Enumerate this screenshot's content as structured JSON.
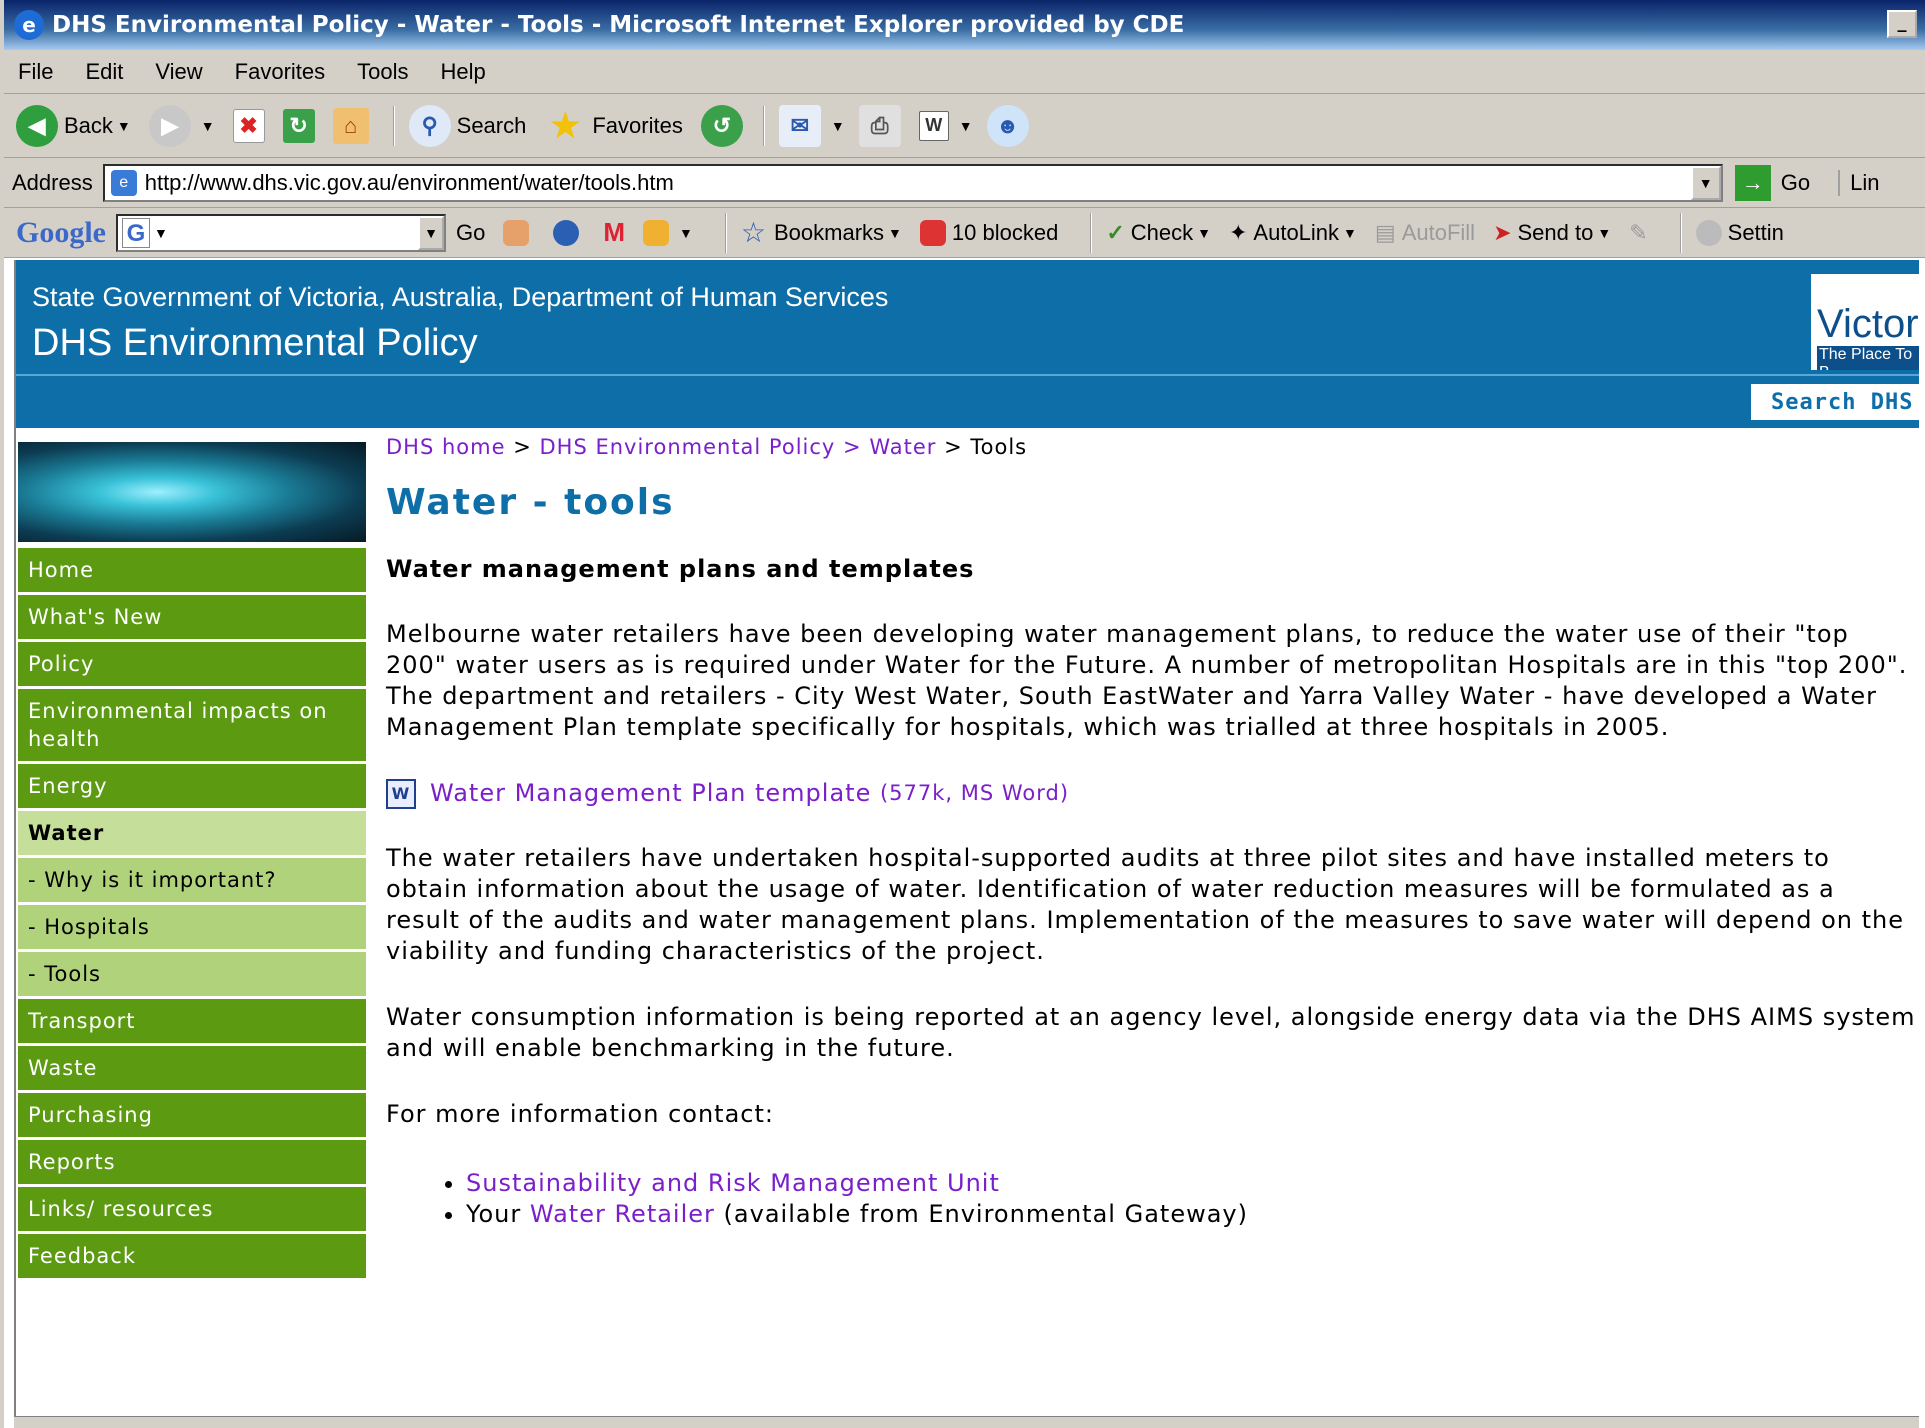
{
  "window": {
    "title": "DHS Environmental Policy - Water - Tools - Microsoft Internet Explorer provided by CDE",
    "minimize": "_"
  },
  "menu": [
    "File",
    "Edit",
    "View",
    "Favorites",
    "Tools",
    "Help"
  ],
  "toolbar": {
    "back": "Back",
    "search": "Search",
    "favorites": "Favorites"
  },
  "address": {
    "label": "Address",
    "url": "http://www.dhs.vic.gov.au/environment/water/tools.htm",
    "go": "Go",
    "links": "Lin"
  },
  "googlebar": {
    "logo": "Google",
    "go": "Go",
    "bookmarks": "Bookmarks",
    "blocked": "10 blocked",
    "check": "Check",
    "autolink": "AutoLink",
    "autofill": "AutoFill",
    "sendto": "Send to",
    "settings": "Settin"
  },
  "header": {
    "org": "State Government of Victoria, Australia, Department of Human Services",
    "site": "DHS Environmental Policy",
    "logo_text": "Victori",
    "logo_tagline": "The Place To B",
    "search_btn": "Search DHS"
  },
  "nav": [
    {
      "label": "Home"
    },
    {
      "label": "What's New"
    },
    {
      "label": "Policy"
    },
    {
      "label": "Environmental impacts on health"
    },
    {
      "label": "Energy"
    },
    {
      "label": "Water"
    },
    {
      "label": "- Why is it important?"
    },
    {
      "label": "- Hospitals"
    },
    {
      "label": "- Tools"
    },
    {
      "label": "Transport"
    },
    {
      "label": "Waste"
    },
    {
      "label": "Purchasing"
    },
    {
      "label": "Reports"
    },
    {
      "label": "Links/ resources"
    },
    {
      "label": "Feedback"
    }
  ],
  "breadcrumb": {
    "home": "DHS home",
    "sep": ">",
    "policy": "DHS Environmental Policy",
    "water": "Water",
    "current": "Tools"
  },
  "content": {
    "title": "Water - tools",
    "section": "Water management plans and templates",
    "p1": "Melbourne water retailers have been developing water management plans, to reduce the water use of their \"top 200\" water users as is required under Water for the Future. A number of metropolitan Hospitals are in this \"top 200\". The department and retailers - City West Water, South EastWater and Yarra Valley Water - have developed a Water Management Plan template specifically for hospitals, which was trialled at three hospitals in 2005.",
    "doc_link": "Water Management Plan template",
    "doc_meta": "(577k, MS Word)",
    "p2": "The water retailers have undertaken hospital-supported audits at three pilot sites and have installed meters to obtain information about the usage of water. Identification of water reduction measures will be formulated as a result of the audits and water management plans. Implementation of the measures to save water will depend on the viability and funding characteristics of the project.",
    "p3": "Water consumption information is being reported at an agency level, alongside energy data via the DHS AIMS system and will enable benchmarking in the future.",
    "p4": "For more information contact:",
    "contact1": "Sustainability and Risk Management Unit",
    "contact2_pre": "Your",
    "contact2_link": "Water Retailer",
    "contact2_post": "(available from Environmental Gateway)"
  }
}
